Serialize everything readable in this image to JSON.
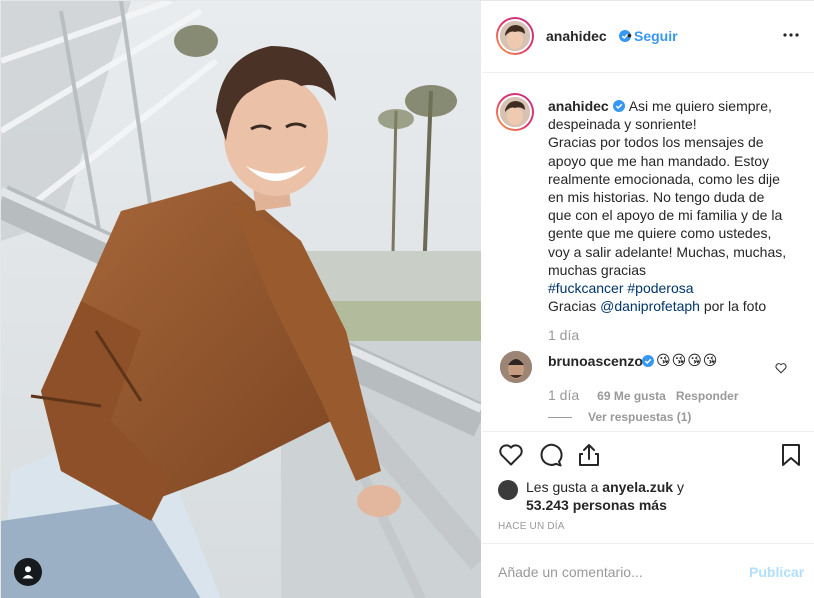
{
  "post": {
    "author": "anahidec",
    "follow_label": "Seguir",
    "separator": "•",
    "caption_lines": [
      "Asi me quiero siempre,",
      "despeinada y sonriente!",
      "Gracias por todos los mensajes de",
      "apoyo que me han mandado. Estoy",
      "realmente emocionada, como les dije",
      "en mis historias. No tengo duda de",
      "que con el apoyo de mi familia y de la",
      "gente que me quiere como ustedes,",
      "voy a salir adelante! Muchas, muchas,",
      "muchas gracias"
    ],
    "hashtags": "#fuckcancer #poderosa",
    "credit_prefix": "Gracias ",
    "credit_mention": "@daniprofetaph",
    "credit_suffix": " por la foto",
    "caption_time": "1 día"
  },
  "reply": {
    "username": "brunoascenzo",
    "emojis": "😘😘😘😘",
    "time": "1 día",
    "likes": "69 Me gusta",
    "respond_label": "Responder",
    "view_replies": "Ver respuestas (1)"
  },
  "likes": {
    "prefix": "Les gusta a ",
    "first_user": "anyela.zuk",
    "conjunction": " y",
    "count": "53.243 personas más"
  },
  "timestamp": "HACE UN DÍA",
  "comment_box": {
    "placeholder": "Añade un comentario...",
    "publish_label": "Publicar"
  },
  "colors": {
    "link_blue": "#3897f0",
    "verified_blue": "#3897f0",
    "muted": "#999999",
    "publish_disabled": "#b2dffc"
  },
  "icons": {
    "more": "more-horizontal-icon",
    "like": "heart-icon",
    "comment": "comment-icon",
    "share": "share-icon",
    "save": "bookmark-icon",
    "tag": "user-tag-icon"
  }
}
